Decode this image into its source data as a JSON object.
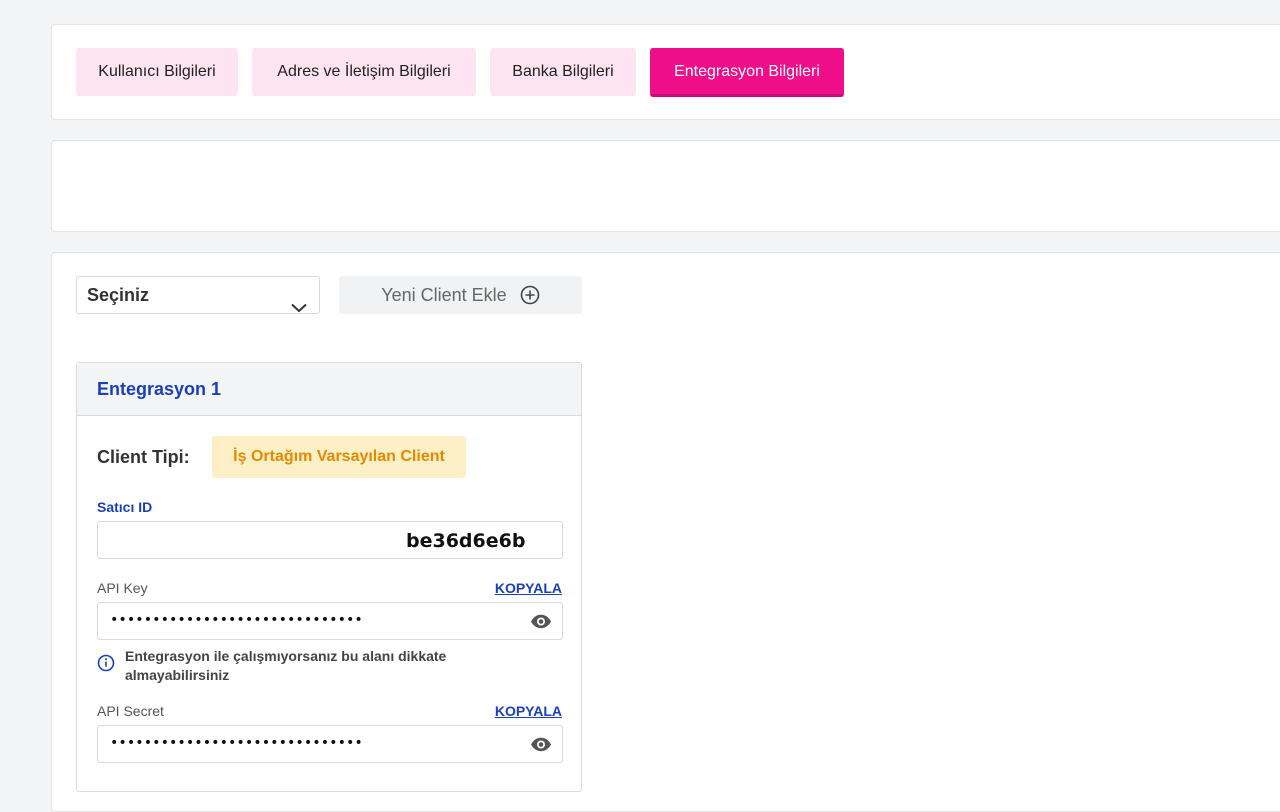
{
  "tabs": [
    {
      "label": "Kullanıcı Bilgileri",
      "active": false
    },
    {
      "label": "Adres ve İletişim Bilgileri",
      "active": false
    },
    {
      "label": "Banka Bilgileri",
      "active": false
    },
    {
      "label": "Entegrasyon Bilgileri",
      "active": true
    }
  ],
  "toolbar": {
    "select_value": "Seçiniz",
    "add_client_label": "Yeni Client Ekle"
  },
  "integration": {
    "title": "Entegrasyon 1",
    "client_type_label": "Client Tipi:",
    "client_type_value": "İş Ortağım Varsayılan Client",
    "seller_id_label": "Satıcı ID",
    "seller_id_value": "be36d6e6b",
    "api_key_label": "API Key",
    "api_key_copy": "KOPYALA",
    "api_key_masked": "••••••••••••••••••••••••••••••",
    "info_text": "Entegrasyon ile çalışmıyorsanız bu alanı dikkate almayabilirsiniz",
    "api_secret_label": "API Secret",
    "api_secret_copy": "KOPYALA",
    "api_secret_masked": "••••••••••••••••••••••••••••••"
  },
  "colors": {
    "accent": "#ef0d8a",
    "tab_bg": "#fde4f0",
    "link": "#1b3fb8",
    "badge_bg": "#fdf0c6",
    "badge_text": "#e58a00"
  },
  "icons": [
    "chevron-down-icon",
    "plus-circle-icon",
    "eye-icon",
    "info-icon"
  ]
}
